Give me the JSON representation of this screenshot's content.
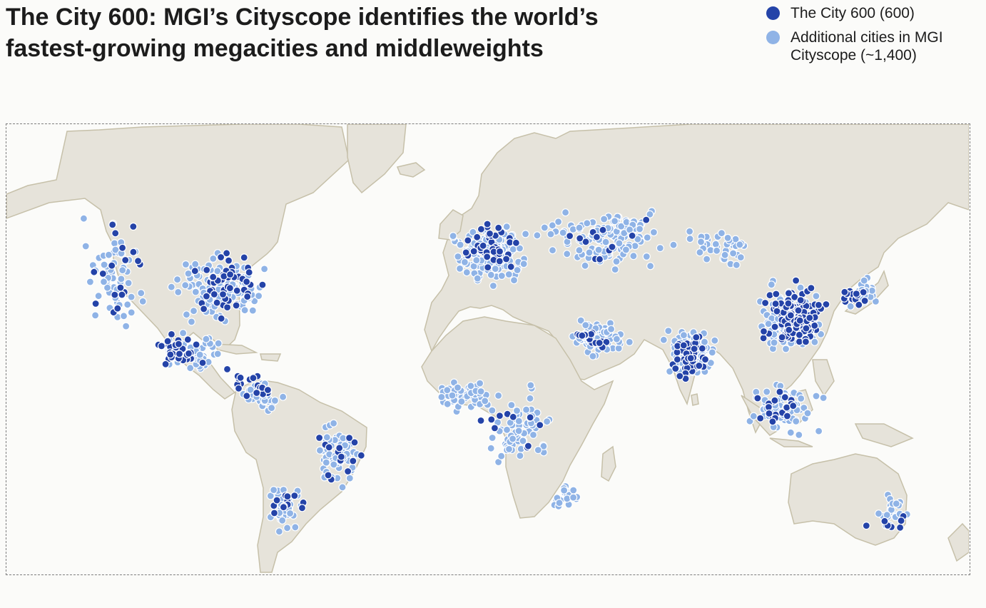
{
  "title": "The City 600: MGI’s Cityscope identifies the world’s fastest-growing megacities and middleweights",
  "legend": [
    {
      "label": "The City 600 (600)",
      "color": "#2443a8"
    },
    {
      "label": "Additional cities in MGI Cityscope (~1,400)",
      "color": "#8fb3e6"
    }
  ],
  "colors": {
    "land": "#e6e3da",
    "coast": "#c6c0a9",
    "ocean": "#fbfbf9",
    "city600": "#2443a8",
    "additional": "#8fb3e6",
    "dot_outline": "#ffffff"
  },
  "map": {
    "projection": "equirectangular world map",
    "city600_clusters": [
      {
        "region": "Western United States",
        "n": 18
      },
      {
        "region": "Eastern United States",
        "n": 50
      },
      {
        "region": "Mexico",
        "n": 30
      },
      {
        "region": "Central America and Caribbean",
        "n": 12
      },
      {
        "region": "Colombia and Venezuela",
        "n": 10
      },
      {
        "region": "Brazil",
        "n": 14
      },
      {
        "region": "Southern Cone",
        "n": 12
      },
      {
        "region": "Western Europe",
        "n": 45
      },
      {
        "region": "Eastern Europe and Russia",
        "n": 12
      },
      {
        "region": "Middle East",
        "n": 14
      },
      {
        "region": "Sub-Saharan Africa",
        "n": 10
      },
      {
        "region": "India",
        "n": 40
      },
      {
        "region": "China",
        "n": 125
      },
      {
        "region": "Japan and Korea",
        "n": 14
      },
      {
        "region": "Southeast Asia",
        "n": 20
      },
      {
        "region": "Australia and New Zealand",
        "n": 7
      }
    ],
    "additional_cities_approx": 1400
  }
}
